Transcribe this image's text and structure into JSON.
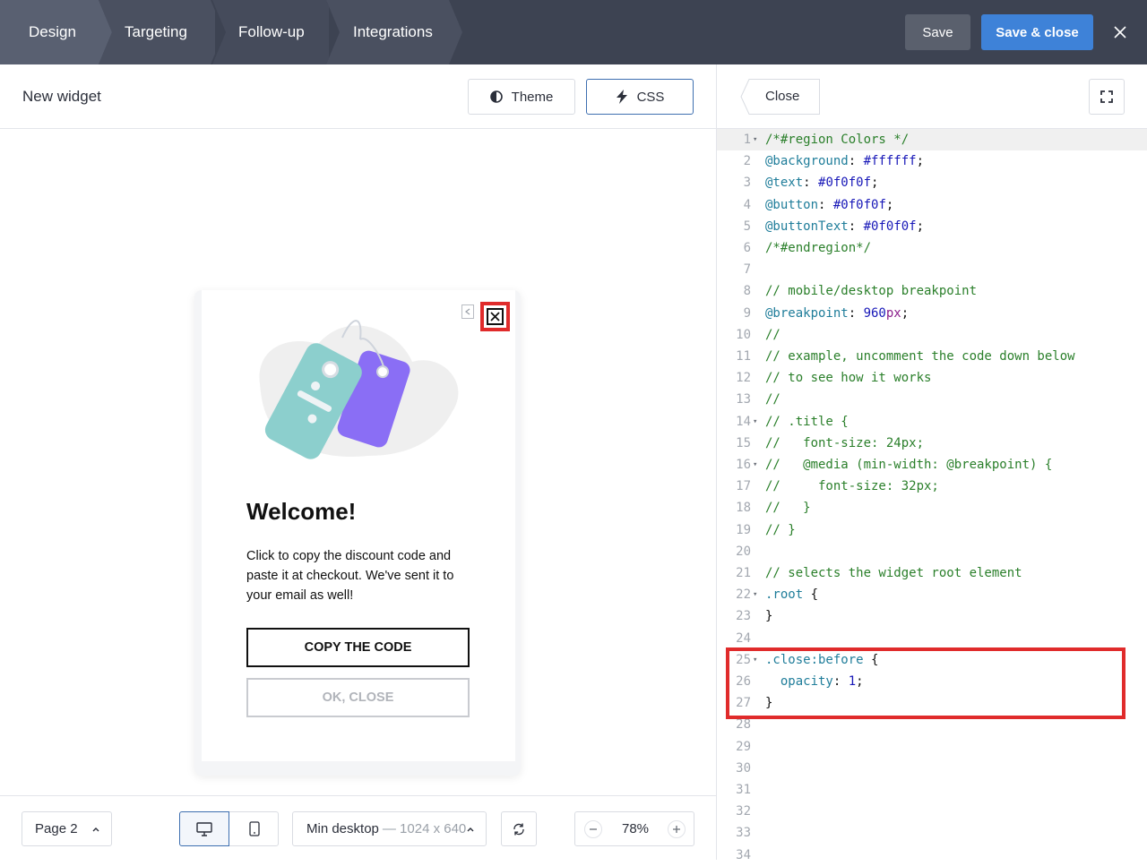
{
  "topbar": {
    "steps": [
      "Design",
      "Targeting",
      "Follow-up",
      "Integrations"
    ],
    "save_label": "Save",
    "save_close_label": "Save & close"
  },
  "left": {
    "widget_name": "New widget",
    "theme_label": "Theme",
    "css_label": "CSS",
    "widget": {
      "heading": "Welcome!",
      "body": "Click to copy the discount code and paste it at checkout. We've sent it to your email as well!",
      "copy_label": "COPY THE CODE",
      "ok_label": "OK, CLOSE"
    },
    "footer": {
      "page_label": "Page 2",
      "device_label": "Min desktop",
      "device_size": "— 1024 x 640",
      "zoom": "78%"
    }
  },
  "right": {
    "close_label": "Close",
    "code_lines": [
      "/*#region Colors */",
      "@background: #ffffff;",
      "@text: #0f0f0f;",
      "@button: #0f0f0f;",
      "@buttonText: #0f0f0f;",
      "/*#endregion*/",
      "",
      "// mobile/desktop breakpoint",
      "@breakpoint: 960px;",
      "//",
      "// example, uncomment the code down below",
      "// to see how it works",
      "//",
      "// .title {",
      "//   font-size: 24px;",
      "//   @media (min-width: @breakpoint) {",
      "//     font-size: 32px;",
      "//   }",
      "// }",
      "",
      "// selects the widget root element",
      ".root {",
      "}",
      "",
      ".close:before {",
      "  opacity: 1;",
      "}",
      "",
      "",
      "",
      "",
      "",
      "",
      ""
    ]
  },
  "colors": {
    "topbar": "#3d4352",
    "primary": "#3e82d8",
    "highlight": "#e02b2b"
  }
}
